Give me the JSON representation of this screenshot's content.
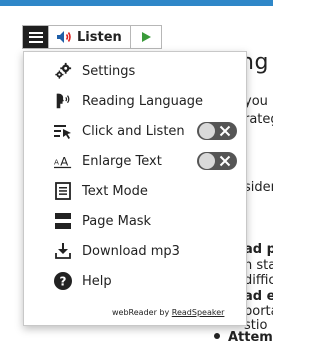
{
  "page_fragments": {
    "heading": "ng Y",
    "line1": "you",
    "line2": "rateg",
    "line3": "sider",
    "line4": "ad p",
    "line5": "n sta",
    "line6": "diffic",
    "line7": "ad e",
    "line8": "porta",
    "line9": "stio",
    "bullet": "Attemp"
  },
  "toolbar": {
    "listen_label": "Listen"
  },
  "menu": {
    "items": [
      {
        "label": "Settings",
        "icon": "gears-icon"
      },
      {
        "label": "Reading Language",
        "icon": "speaking-head-icon"
      },
      {
        "label": "Click and Listen",
        "icon": "click-pointer-icon",
        "toggle": "off"
      },
      {
        "label": "Enlarge Text",
        "icon": "enlarge-text-icon",
        "toggle": "off"
      },
      {
        "label": "Text Mode",
        "icon": "document-icon"
      },
      {
        "label": "Page Mask",
        "icon": "page-mask-icon"
      },
      {
        "label": "Download mp3",
        "icon": "download-icon"
      },
      {
        "label": "Help",
        "icon": "help-icon"
      }
    ],
    "powered_by_prefix": "webReader by",
    "powered_by_link": "ReadSpeaker"
  },
  "colors": {
    "top_accent": "#2f87c8",
    "play_green": "#3a9b3a",
    "toggle_bg": "#555555"
  }
}
